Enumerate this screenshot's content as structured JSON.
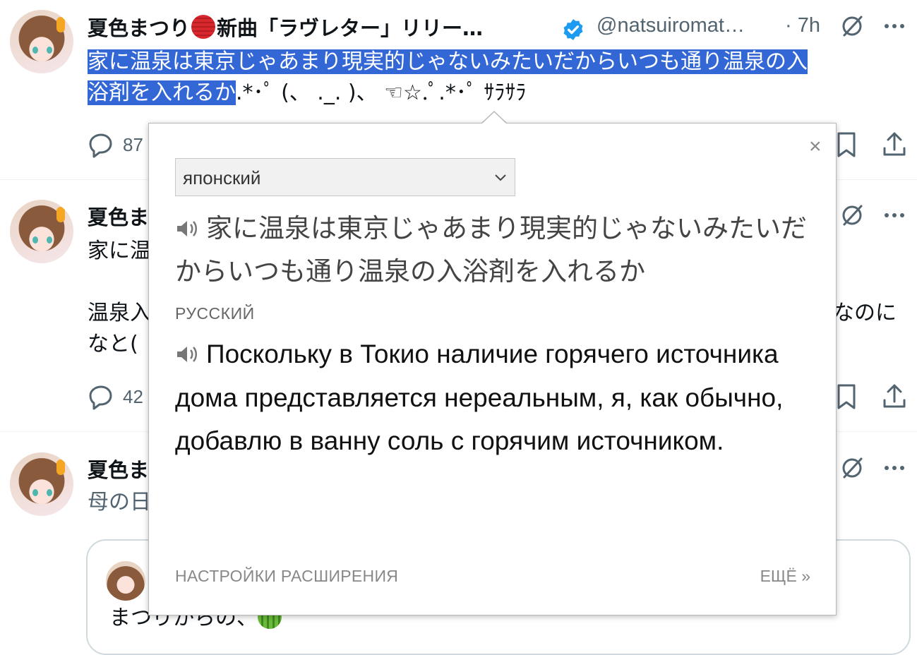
{
  "tweets": [
    {
      "name": "夏色まつり",
      "name_suffix": "新曲「ラヴレター」リリー…",
      "handle": "@natsuiromat…",
      "time": "· 7h",
      "text_selected_1": "家に温泉は東京じゃあまり現実的じゃないみたいだからいつも通り温泉の入",
      "text_selected_2": "浴剤を入れるか",
      "text_rest": ".*･ﾟ (、 ._. )、 ☜☆.ﾟ.*･ﾟ ｻﾗｻﾗ",
      "reply_count": "87"
    },
    {
      "name": "夏色ま",
      "line1": "家に温",
      "line2_left": "温泉入",
      "line2_right": "なのに",
      "line3": "なと(",
      "reply_count": "42"
    },
    {
      "name": "夏色ま",
      "line1": "母の日",
      "quote_text": "まつりからの、"
    }
  ],
  "popup": {
    "source_language": "японский",
    "source_text": "家に温泉は東京じゃあまり現実的じゃないみたいだからいつも通り温泉の入浴剤を入れるか",
    "target_language": "РУССКИЙ",
    "translation": "Поскольку в Токио наличие горячего источника дома представляется нереальным, я, как обычно, добавлю в ванну соль с горячим источником.",
    "close_label": "×",
    "settings_link": "НАСТРОЙКИ РАСШИРЕНИЯ",
    "more_link": "ЕЩЁ »"
  },
  "icons": {
    "verified": "verified-badge-icon",
    "grok": "grok-icon",
    "more": "more-icon",
    "reply": "reply-icon",
    "bookmark": "bookmark-icon",
    "share": "share-icon",
    "speaker": "speaker-icon",
    "chevron": "chevron-down-icon"
  },
  "colors": {
    "selection": "#3367d6",
    "verified": "#1d9bf0",
    "muted": "#536471"
  }
}
